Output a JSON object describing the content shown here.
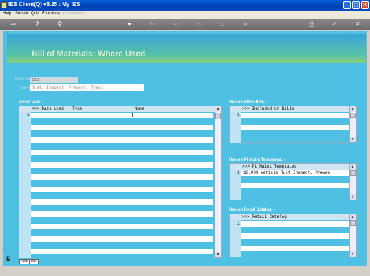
{
  "window": {
    "title": "IES Client(Q) v8.25 : My IES",
    "min_glyph": "_",
    "max_glyph": "□",
    "close_glyph": "✕"
  },
  "menu": {
    "items": [
      "Help",
      "Submit",
      "Quit",
      "Functions"
    ],
    "disabled_item": "Commands"
  },
  "toolbar": {
    "icons": [
      "key-icon",
      "help-icon",
      "search-icon",
      "heart-icon",
      "refresh-icon",
      "rewind-icon",
      "fast-forward-icon",
      "pin-icon",
      "stop-icon",
      "print-icon",
      "confirm-icon",
      "close-icon"
    ]
  },
  "header": {
    "title": "Bill of Materials: Where Used"
  },
  "form": {
    "bom_label": "BOM No",
    "bom_value": "111",
    "name_label": "Name",
    "name_value": "Rust, Inspect, Prevent, Treat"
  },
  "direct_use": {
    "section_title": "Direct Use: -",
    "columns": [
      ">>> Date Used",
      "Type",
      "Name"
    ],
    "rows": [
      {
        "num": "1",
        "date": "",
        "type": "",
        "name": ""
      }
    ]
  },
  "other_bills": {
    "section_title": "Use on other Bills: -",
    "header": ">>> Included on Bills",
    "rows": [
      {
        "num": "1",
        "value": ""
      }
    ]
  },
  "pt_templates": {
    "section_title": "Use on Pt Maint Templates: -",
    "header": ">>> Pt Maint Templates",
    "rows": [
      {
        "num": "1",
        "value": "10,000 Vehicle Rust Inspect, Preven"
      }
    ]
  },
  "retail_catalog": {
    "section_title": "Use on Retail Catalog: -",
    "header": ">>> Retail Catalog",
    "rows": [
      {
        "num": "1",
        "value": ""
      }
    ]
  },
  "bottom_tabs": {
    "first": "Vew",
    "second": "Pre"
  },
  "side_marks": {
    "top": "Vew",
    "bottom": "E"
  }
}
